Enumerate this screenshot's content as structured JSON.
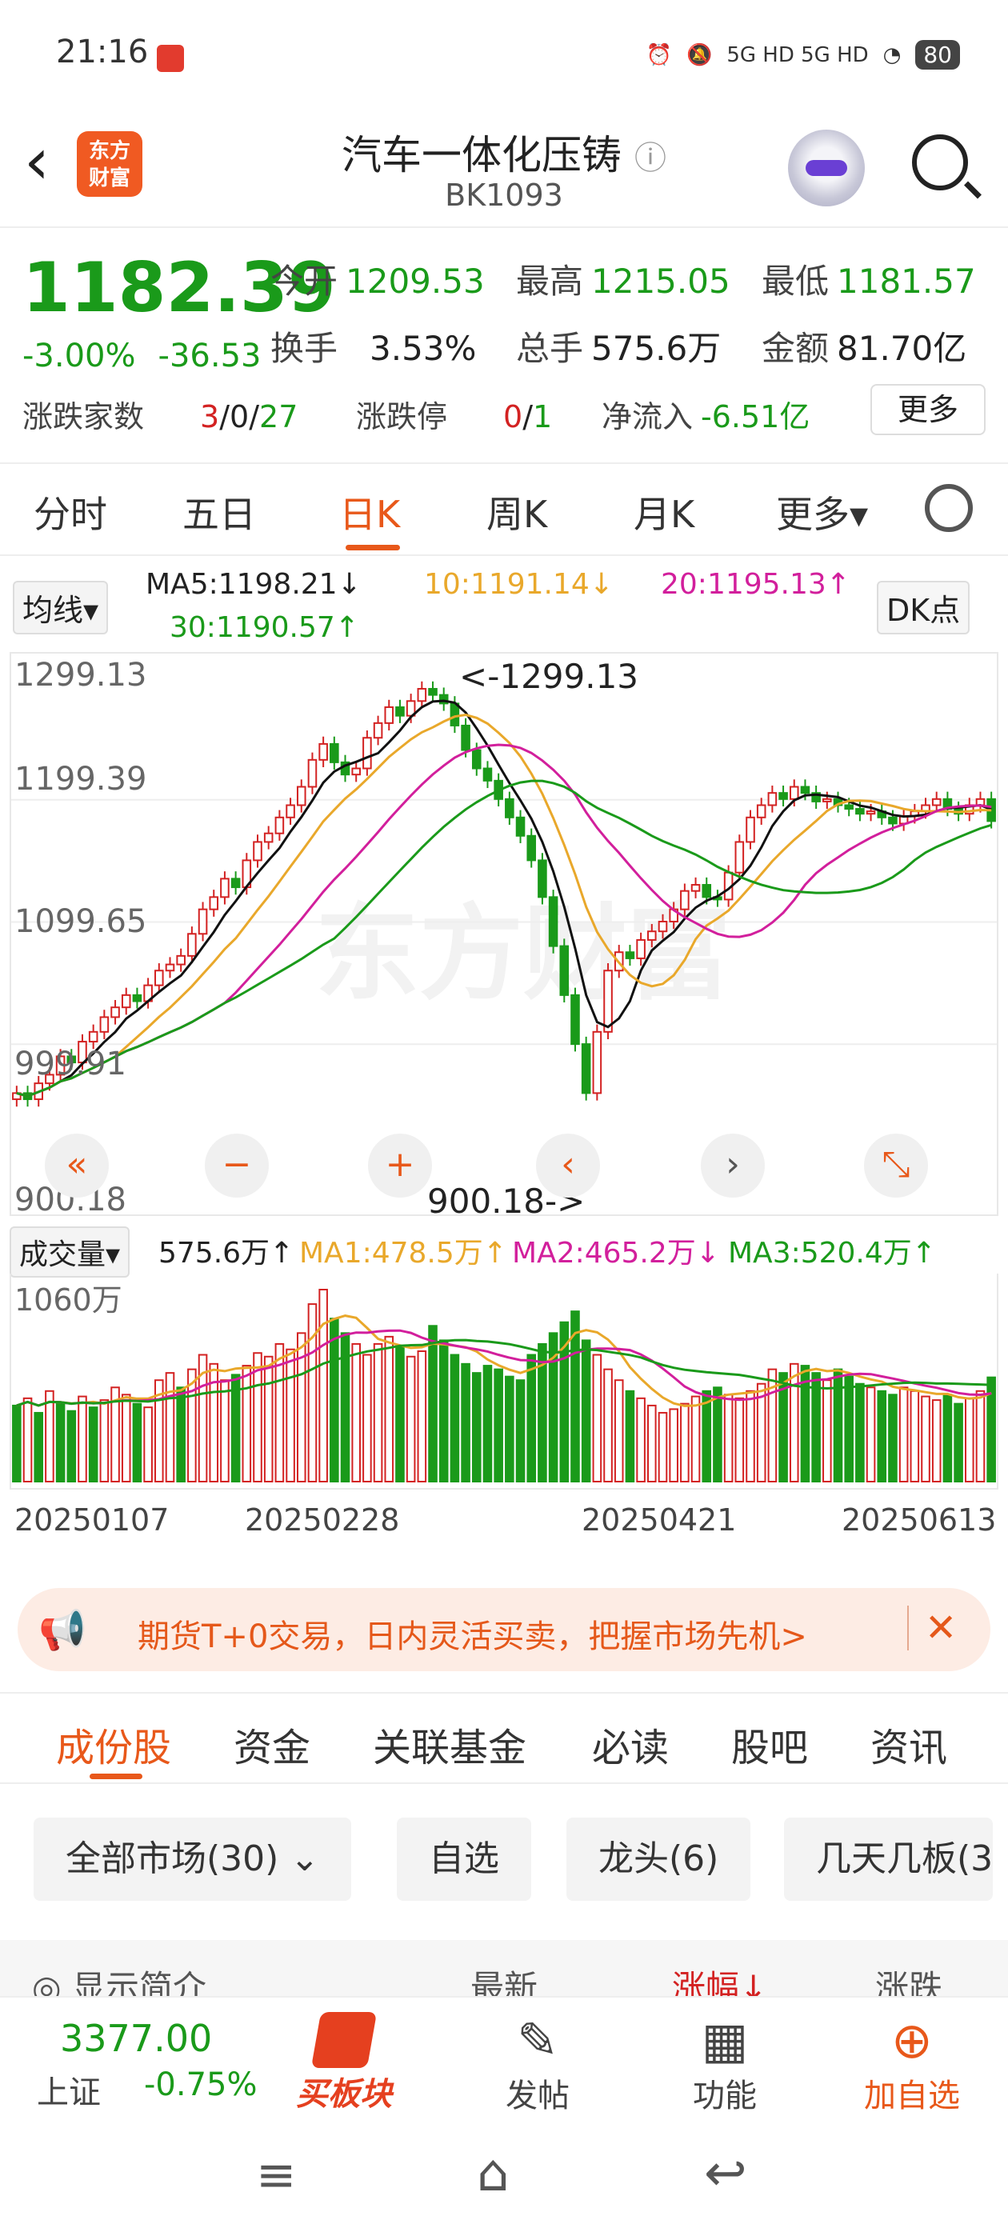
{
  "status_bar": {
    "time": "21:16",
    "network": "5G HD  5G HD",
    "battery": "80"
  },
  "header": {
    "back_icon": "chevron-left",
    "logo_line1": "东方",
    "logo_line2": "财富",
    "title": "汽车一体化压铸",
    "info_icon": "ⓘ",
    "code": "BK1093"
  },
  "quote": {
    "price": "1182.39",
    "change_pct": "-3.00%",
    "change_abs": "-36.53",
    "open_label": "今开",
    "open": "1209.53",
    "high_label": "最高",
    "high": "1215.05",
    "low_label": "最低",
    "low": "1181.57",
    "turnover_label": "换手",
    "turnover": "3.53%",
    "volume_label": "总手",
    "volume": "575.6万",
    "amount_label": "金额",
    "amount": "81.70亿",
    "updown_label": "涨跌家数",
    "up": "3",
    "flat": "0",
    "down": "27",
    "limit_label": "涨跌停",
    "limit_up": "0",
    "limit_down": "1",
    "netflow_label": "净流入",
    "netflow": "-6.51亿",
    "more_label": "更多"
  },
  "chart_tabs": {
    "items": [
      "分时",
      "五日",
      "日K",
      "周K",
      "月K",
      "更多▾"
    ],
    "active": "日K"
  },
  "ma_row": {
    "selector": "均线▾",
    "ma5": "MA5:1198.21↓",
    "ma10": "10:1191.14↓",
    "ma20": "20:1195.13↑",
    "ma30": "30:1190.57↑",
    "dk": "DK点"
  },
  "kline": {
    "y_labels": [
      "1299.13",
      "1199.39",
      "1099.65",
      "999.91",
      "900.18"
    ],
    "max_note": "<-1299.13",
    "min_note": "900.18->",
    "watermark": "东方财富"
  },
  "volume_head": {
    "selector": "成交量▾",
    "vol": "575.6万↑",
    "ma1": "MA1:478.5万↑",
    "ma2": "MA2:465.2万↓",
    "ma3": "MA3:520.4万↑",
    "ylab": "1060万"
  },
  "dates": [
    "20250107",
    "20250228",
    "20250421",
    "20250613"
  ],
  "promo": {
    "text": "期货T+0交易，日内灵活买卖，把握市场先机>",
    "close": "✕"
  },
  "sub_tabs": {
    "items": [
      "成份股",
      "资金",
      "关联基金",
      "必读",
      "股吧",
      "资讯"
    ],
    "active": "成份股"
  },
  "filters": [
    "全部市场(30)",
    "自选",
    "龙头(6)",
    "几天几板(3"
  ],
  "columns": {
    "show_intro": "显示简介",
    "latest": "最新",
    "pct": "涨幅↓",
    "change": "涨跌"
  },
  "bottom_bar": {
    "index_value": "3377.00",
    "index_name": "上证",
    "index_pct": "-0.75%",
    "buy_label": "买板块",
    "post_label": "发帖",
    "func_label": "功能",
    "add_label": "加自选"
  },
  "chart_data": [
    {
      "type": "candlestick",
      "title": "",
      "ylim": [
        900.18,
        1299.13
      ],
      "x_ticks": [
        "20250107",
        "20250228",
        "20250421",
        "20250613"
      ],
      "series": [
        {
          "name": "MA5",
          "last": 1198.21
        },
        {
          "name": "MA10",
          "last": 1191.14
        },
        {
          "name": "MA20",
          "last": 1195.13
        },
        {
          "name": "MA30",
          "last": 1190.57
        }
      ],
      "close": [
        960,
        955,
        968,
        975,
        990,
        985,
        1002,
        1010,
        1022,
        1030,
        1040,
        1035,
        1048,
        1060,
        1065,
        1072,
        1090,
        1110,
        1120,
        1135,
        1128,
        1150,
        1165,
        1172,
        1185,
        1195,
        1210,
        1232,
        1245,
        1230,
        1220,
        1225,
        1250,
        1262,
        1275,
        1268,
        1280,
        1290,
        1285,
        1278,
        1260,
        1240,
        1225,
        1215,
        1200,
        1185,
        1170,
        1150,
        1120,
        1080,
        1040,
        1000,
        960,
        1010,
        1060,
        1075,
        1070,
        1085,
        1092,
        1100,
        1110,
        1125,
        1130,
        1120,
        1118,
        1140,
        1165,
        1185,
        1195,
        1205,
        1200,
        1210,
        1205,
        1198,
        1200,
        1195,
        1192,
        1188,
        1190,
        1185,
        1180,
        1186,
        1190,
        1195,
        1200,
        1192,
        1188,
        1195,
        1200,
        1182
      ]
    },
    {
      "type": "bar",
      "title": "成交量",
      "ylim": [
        0,
        1060
      ],
      "unit": "万",
      "series": [
        {
          "name": "MA1",
          "last": 478.5
        },
        {
          "name": "MA2",
          "last": 465.2
        },
        {
          "name": "MA3",
          "last": 520.4
        }
      ],
      "values": [
        420,
        460,
        380,
        500,
        430,
        390,
        470,
        410,
        450,
        520,
        480,
        430,
        410,
        560,
        600,
        520,
        620,
        700,
        650,
        560,
        590,
        640,
        710,
        690,
        760,
        730,
        820,
        980,
        1060,
        900,
        820,
        760,
        700,
        760,
        800,
        740,
        690,
        720,
        860,
        780,
        700,
        650,
        600,
        640,
        620,
        580,
        560,
        700,
        760,
        820,
        880,
        940,
        780,
        700,
        620,
        560,
        500,
        460,
        420,
        380,
        400,
        430,
        470,
        500,
        520,
        480,
        460,
        500,
        540,
        620,
        600,
        650,
        640,
        600,
        560,
        620,
        580,
        540,
        520,
        500,
        480,
        520,
        500,
        470,
        450,
        480,
        430,
        460,
        500,
        575.6
      ],
      "up": [
        0,
        1,
        0,
        1,
        0,
        0,
        1,
        0,
        1,
        1,
        1,
        0,
        1,
        1,
        1,
        0,
        1,
        1,
        1,
        1,
        0,
        1,
        1,
        1,
        1,
        1,
        1,
        1,
        1,
        0,
        0,
        1,
        1,
        1,
        1,
        0,
        1,
        1,
        0,
        0,
        0,
        0,
        0,
        0,
        0,
        0,
        0,
        0,
        0,
        0,
        0,
        0,
        0,
        1,
        1,
        1,
        0,
        1,
        1,
        1,
        1,
        1,
        1,
        0,
        0,
        1,
        1,
        1,
        1,
        1,
        0,
        1,
        0,
        0,
        1,
        0,
        0,
        0,
        1,
        0,
        0,
        1,
        1,
        1,
        1,
        0,
        0,
        1,
        1,
        0
      ]
    }
  ]
}
